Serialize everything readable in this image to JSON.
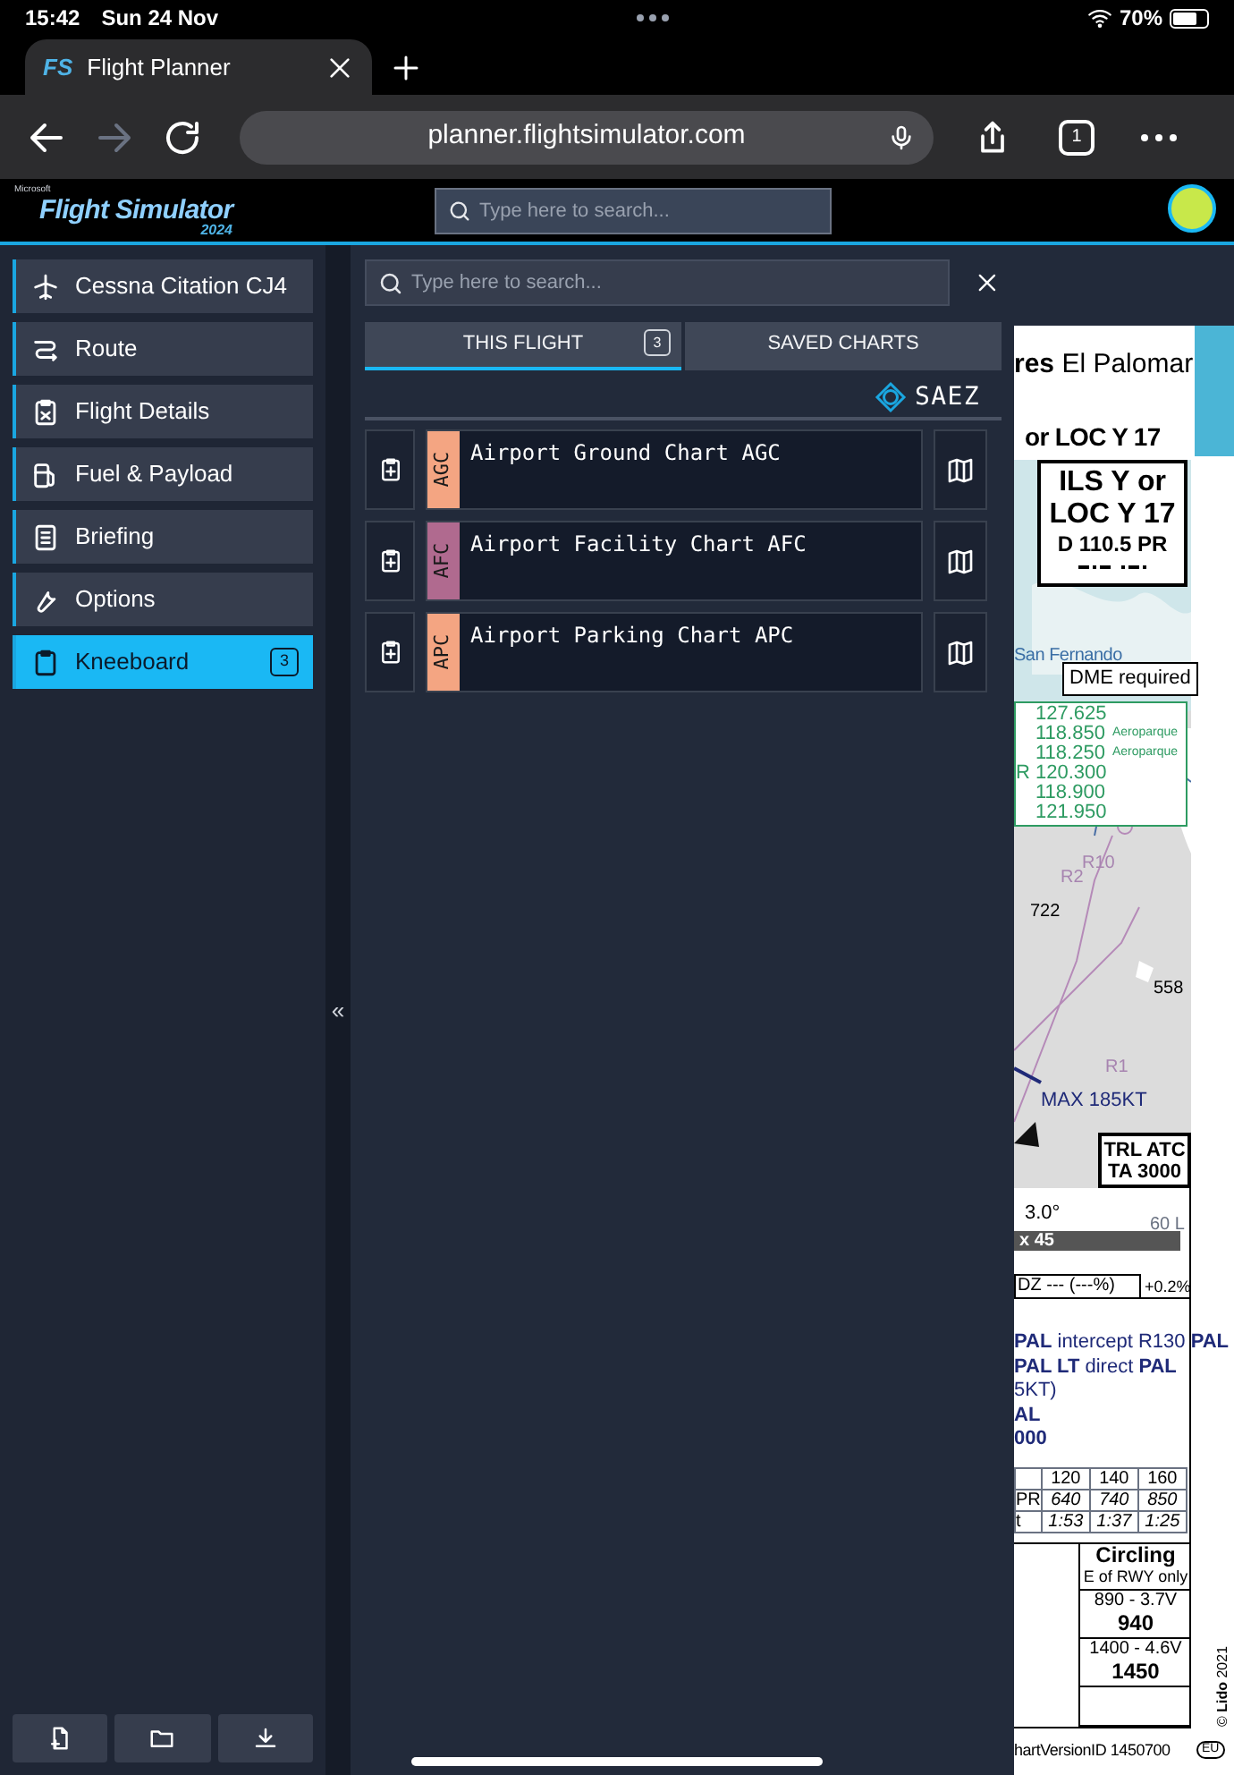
{
  "status_bar": {
    "time": "15:42",
    "date": "Sun 24 Nov",
    "battery": "70%"
  },
  "browser": {
    "favicon": "FS",
    "tab_title": "Flight Planner",
    "url": "planner.flightsimulator.com",
    "tab_count": "1",
    "navigation": [
      {
        "kind": "back",
        "disabled": false
      },
      {
        "kind": "forward",
        "disabled": true
      },
      {
        "kind": "reload",
        "disabled": false
      }
    ]
  },
  "app_header": {
    "logo": {
      "brand": "Microsoft",
      "name": "Flight Simulator",
      "year": "2024"
    },
    "search": {
      "placeholder": "Type here to search..."
    }
  },
  "sidebar": {
    "items": [
      {
        "kind": "plane",
        "label": "Cessna Citation CJ4",
        "selected": false
      },
      {
        "kind": "route",
        "label": "Route",
        "selected": false
      },
      {
        "kind": "clipboard",
        "label": "Flight Details",
        "selected": false
      },
      {
        "kind": "fuel",
        "label": "Fuel & Payload",
        "selected": false
      },
      {
        "kind": "document",
        "label": "Briefing",
        "selected": false
      },
      {
        "kind": "wrench",
        "label": "Options",
        "selected": false
      },
      {
        "kind": "kneeboard",
        "label": "Kneeboard",
        "selected": true,
        "badge": "3"
      }
    ],
    "actions": [
      {
        "kind": "new"
      },
      {
        "kind": "open"
      },
      {
        "kind": "download"
      }
    ],
    "collapse": "«"
  },
  "kneeboard": {
    "search": {
      "placeholder": "Type here to search..."
    },
    "tabs": [
      {
        "label": "THIS FLIGHT",
        "selected": true,
        "badge": "3"
      },
      {
        "label": "SAVED CHARTS",
        "selected": false
      }
    ],
    "airport": "SAEZ",
    "charts": [
      {
        "code": "AGC",
        "title": "Airport Ground Chart AGC",
        "color": "#f4a582"
      },
      {
        "code": "AFC",
        "title": "Airport Facility Chart AFC",
        "color": "#b06a8f"
      },
      {
        "code": "APC",
        "title": "Airport Parking Chart APC",
        "color": "#f4a582"
      }
    ]
  },
  "chart_document": {
    "title": "**res** El Palomar",
    "procedure": "or LOC Y 17",
    "ident_box": [
      "ILS Y or",
      "LOC Y 17",
      "D 110.5 PR"
    ],
    "place": "San Fernando",
    "dme_note": "DME required",
    "frequencies": [
      {
        "value": "127.625"
      },
      {
        "value": "118.850",
        "note": "Aeroparque"
      },
      {
        "value": "118.250",
        "note": "Aeroparque"
      },
      {
        "prefix": "R",
        "value": "120.300"
      },
      {
        "value": "118.900"
      },
      {
        "value": "121.950"
      }
    ],
    "map_labels": [
      {
        "kind": "area",
        "text": "R10"
      },
      {
        "kind": "area",
        "text": "R2"
      },
      {
        "kind": "elevation",
        "text": "722"
      },
      {
        "kind": "elevation",
        "text": "558"
      },
      {
        "kind": "area",
        "text": "R1"
      },
      {
        "kind": "speed",
        "text": "MAX 185KT"
      }
    ],
    "transition_box": [
      "TRL ATC",
      "TA 3000"
    ],
    "glide": {
      "angle": "3.0°",
      "distance": "60 L",
      "scale": "x 45"
    },
    "tdz": "DZ --- (---%)",
    "gradient": "+0.2%",
    "missed_approach": [
      {
        "text": "**PAL** intercept R130 **PAL**",
        "emphasis": false
      },
      {
        "text": "**PAL LT** direct **PAL**",
        "emphasis": false
      },
      {
        "text": "5KT)",
        "emphasis": false
      },
      {
        "text": "AL",
        "emphasis": true
      },
      {
        "text": "000",
        "emphasis": true
      }
    ],
    "speed_table": {
      "columns": [
        "120",
        "140",
        "160"
      ],
      "rows": [
        {
          "label": "PR",
          "values": [
            "640",
            "740",
            "850"
          ]
        },
        {
          "label": "t",
          "values": [
            "1:53",
            "1:37",
            "1:25"
          ]
        }
      ]
    },
    "minima": {
      "header": "Circling",
      "subheader": "E of RWY only",
      "rows": [
        {
          "value": "890 - 3.7V",
          "altitude": "940"
        },
        {
          "value": "1400 - 4.6V",
          "altitude": "1450"
        }
      ]
    },
    "version": "hartVersionID 1450700",
    "region": "EU",
    "copyright": "© **Lido** 2021"
  }
}
